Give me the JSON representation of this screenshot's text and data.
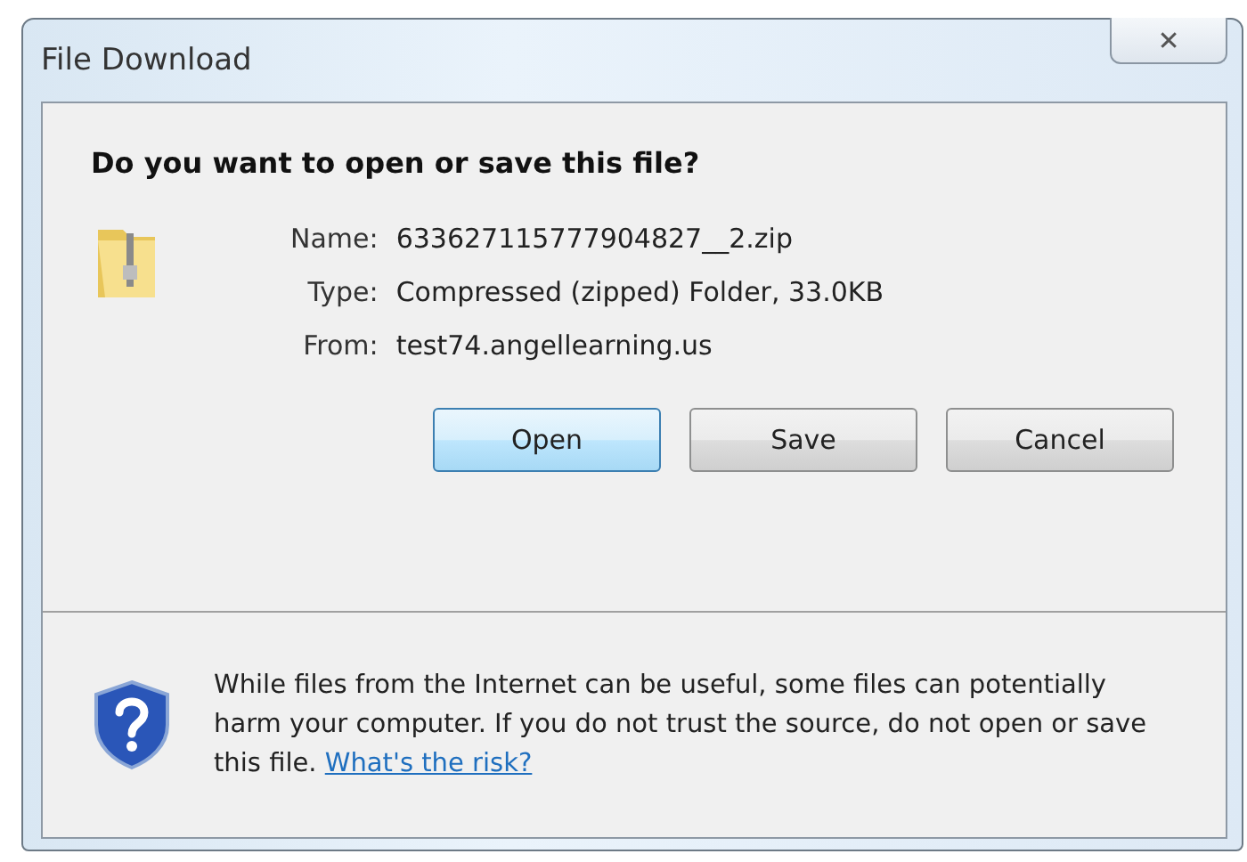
{
  "window": {
    "title": "File Download",
    "close": "✕"
  },
  "heading": "Do you want to open or save this file?",
  "details": [
    {
      "label": "Name:",
      "value": "633627115777904827__2.zip"
    },
    {
      "label": "Type:",
      "value": "Compressed (zipped) Folder, 33.0KB"
    },
    {
      "label": "From:",
      "value": "test74.angellearning.us"
    }
  ],
  "buttons": [
    {
      "label": "Open",
      "default": true
    },
    {
      "label": "Save",
      "default": false
    },
    {
      "label": "Cancel",
      "default": false
    }
  ],
  "warning": {
    "text": "While files from the Internet can be useful, some files can potentially harm your computer. If you do not trust the source, do not open or save this file.",
    "link": "What's the risk?"
  }
}
